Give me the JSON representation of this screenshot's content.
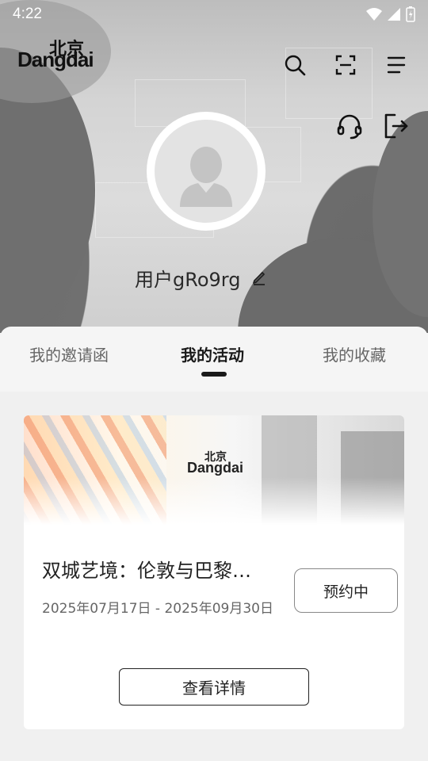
{
  "status_bar": {
    "time": "4:22"
  },
  "header": {
    "logo_text": "Dangdai",
    "logo_chinese": "北京",
    "icons": [
      "search-icon",
      "scan-icon",
      "menu-icon",
      "headset-icon",
      "logout-icon"
    ]
  },
  "profile": {
    "username": "用户gRo9rg"
  },
  "tabs": [
    {
      "label": "我的邀请函",
      "active": false
    },
    {
      "label": "我的活动",
      "active": true
    },
    {
      "label": "我的收藏",
      "active": false
    }
  ],
  "activity_card": {
    "banner_logo": "Dangdai",
    "banner_logo_chinese": "北京",
    "title": "双城艺境：伦敦与巴黎…",
    "date_range": "2025年07月17日 - 2025年09月30日",
    "status_label": "预约中",
    "details_label": "查看详情"
  }
}
